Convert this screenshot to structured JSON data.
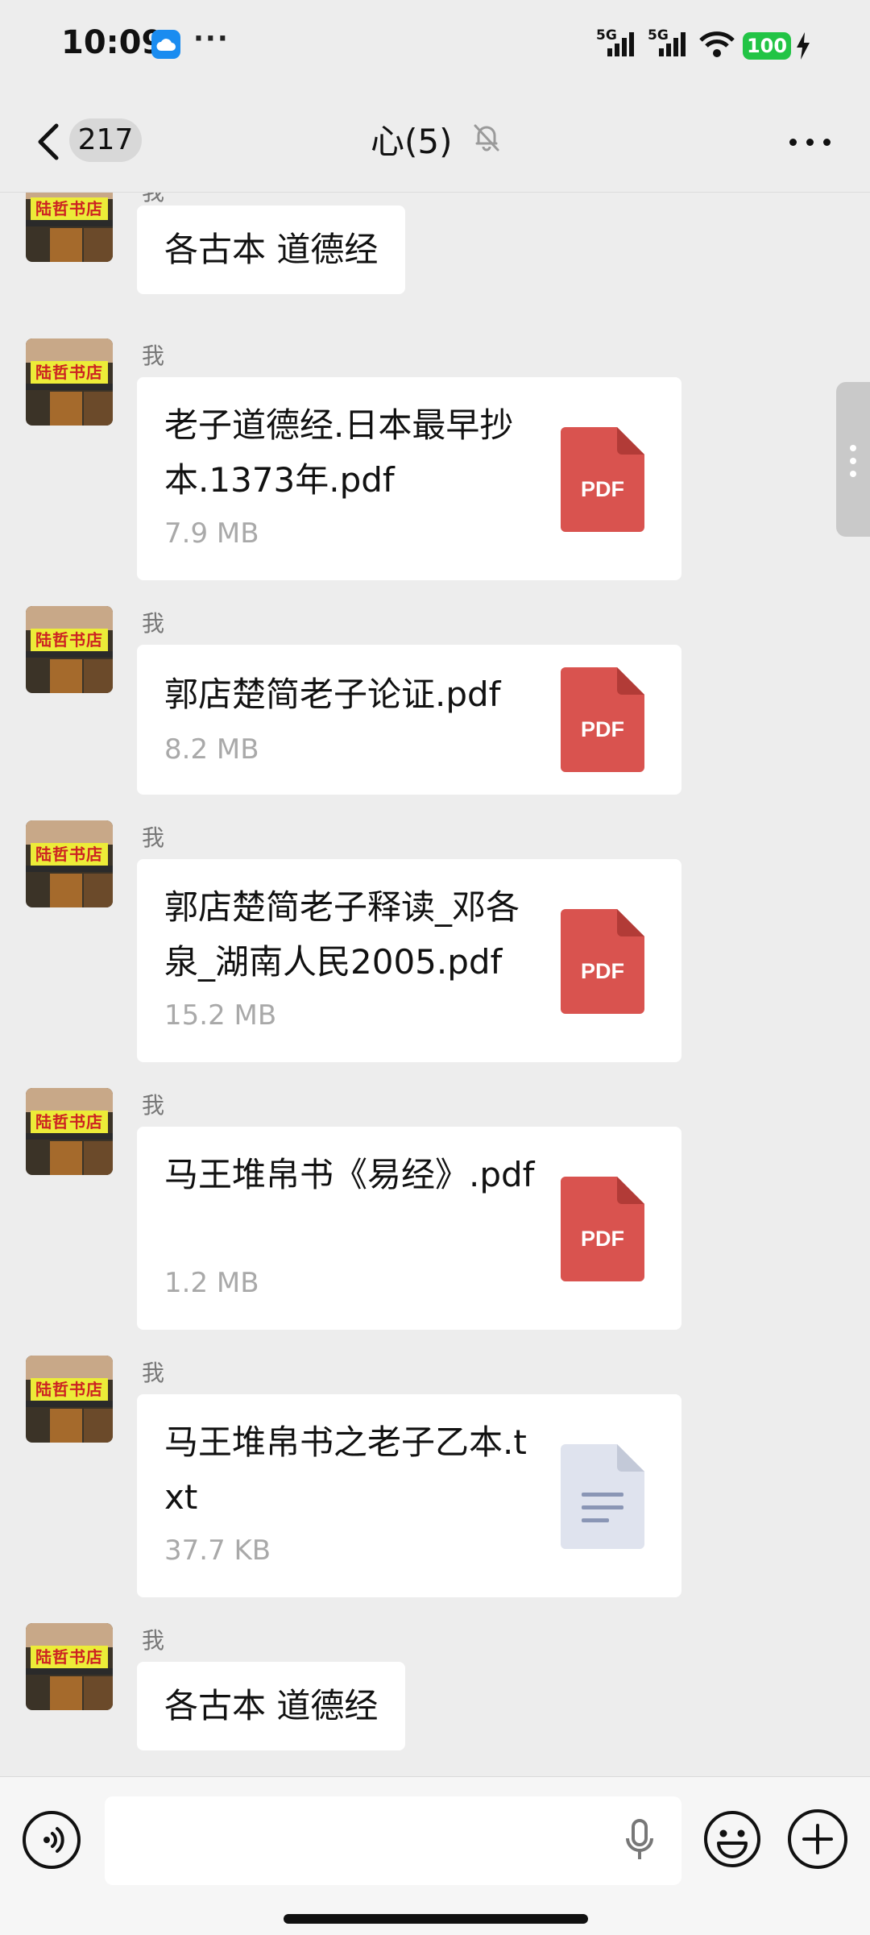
{
  "status_bar": {
    "time": "10:09",
    "more_indicator": "···",
    "signal_1": "5G",
    "signal_2": "5G",
    "battery": "100",
    "icons": [
      "cloud-icon",
      "signal-icon",
      "wifi-icon",
      "battery-icon",
      "charging-icon"
    ]
  },
  "header": {
    "unread_count": "217",
    "title": "心(5)",
    "icons": [
      "back-icon",
      "mute-icon",
      "more-icon"
    ]
  },
  "messages": [
    {
      "sender": "我",
      "type": "text",
      "text": "各古本 道德经"
    },
    {
      "sender": "我",
      "type": "file",
      "file_name": "老子道德经.日本最早抄本.1373年.pdf",
      "file_size": "7.9 MB",
      "file_type": "PDF"
    },
    {
      "sender": "我",
      "type": "file",
      "file_name": "郭店楚简老子论证.pdf",
      "file_size": "8.2 MB",
      "file_type": "PDF"
    },
    {
      "sender": "我",
      "type": "file",
      "file_name": "郭店楚简老子释读_邓各泉_湖南人民2005.pdf",
      "file_size": "15.2 MB",
      "file_type": "PDF"
    },
    {
      "sender": "我",
      "type": "file",
      "file_name": "马王堆帛书《易经》.pdf",
      "file_size": "1.2 MB",
      "file_type": "PDF"
    },
    {
      "sender": "我",
      "type": "file",
      "file_name": "马王堆帛书之老子乙本.txt",
      "file_size": "37.7 KB",
      "file_type": "TXT"
    },
    {
      "sender": "我",
      "type": "text",
      "text": "各古本 道德经"
    }
  ],
  "avatar": {
    "sign_text": "陆哲书店"
  },
  "input_bar": {
    "placeholder": "",
    "icons": [
      "voice-icon",
      "microphone-icon",
      "emoji-icon",
      "plus-icon"
    ]
  },
  "colors": {
    "background": "#ededed",
    "bubble": "#ffffff",
    "pdf_icon": "#d9534f",
    "txt_icon": "#dfe3ee",
    "battery": "#22c445"
  }
}
